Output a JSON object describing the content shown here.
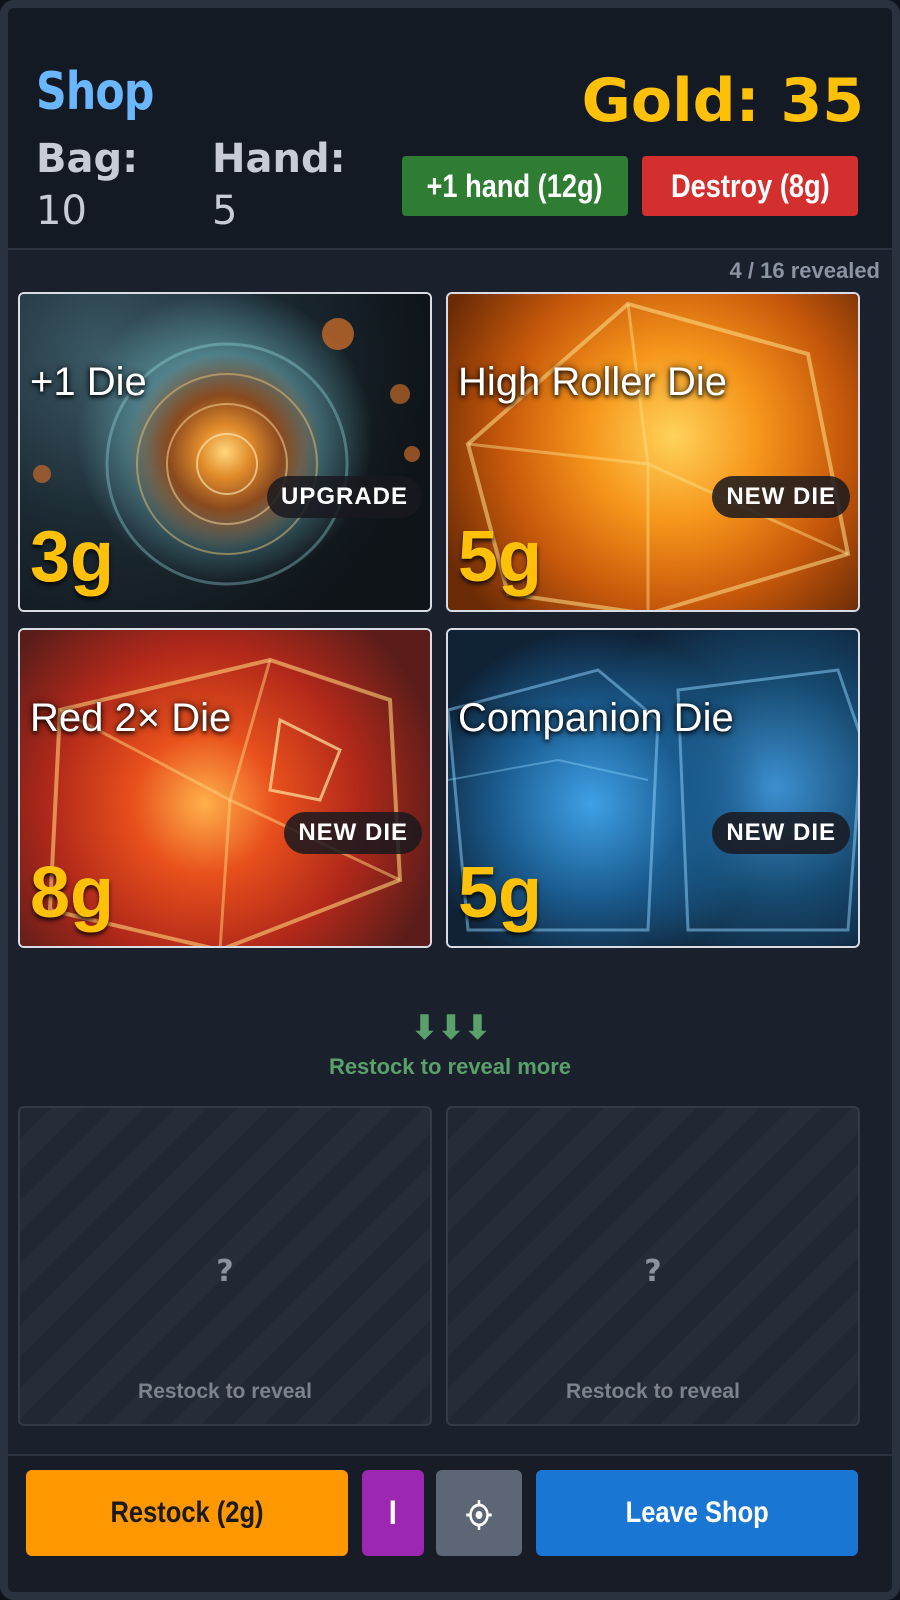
{
  "header": {
    "title": "Shop",
    "bag_label": "Bag:",
    "bag_value": "10",
    "hand_label": "Hand:",
    "hand_value": "5",
    "gold_label": "Gold:",
    "gold_value": "35",
    "buy_hand_label": "+1 hand (12g)",
    "destroy_label": "Destroy (8g)"
  },
  "revealed_text": "4 / 16 revealed",
  "cards": [
    {
      "name": "+1 Die",
      "badge": "UPGRADE",
      "price": "3g"
    },
    {
      "name": "High Roller Die",
      "badge": "NEW DIE",
      "price": "5g"
    },
    {
      "name": "Red 2× Die",
      "badge": "NEW DIE",
      "price": "8g"
    },
    {
      "name": "Companion Die",
      "badge": "NEW DIE",
      "price": "5g"
    }
  ],
  "restock_hint": {
    "arrows": "⬇⬇⬇",
    "text": "Restock to reveal more"
  },
  "locked_cards": [
    {
      "symbol": "?",
      "text": "Restock to reveal"
    },
    {
      "symbol": "?",
      "text": "Restock to reveal"
    }
  ],
  "footer": {
    "restock_label": "Restock (2g)",
    "info_label": "I",
    "settings_icon": "gear-icon",
    "leave_label": "Leave Shop"
  },
  "colors": {
    "accent_gold": "#ffc107",
    "title_blue": "#6ab7ff",
    "green": "#2e7d32",
    "red": "#d32f2f",
    "orange": "#ff9800",
    "purple": "#9c27b0",
    "blue": "#1976d2"
  }
}
